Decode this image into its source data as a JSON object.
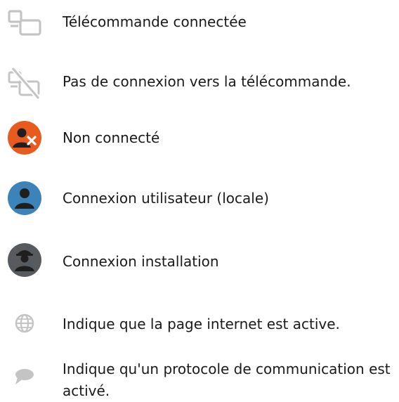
{
  "colors": {
    "icon_grey": "#c4c4c4",
    "not_connected_orange": "#e85a1e",
    "user_blue": "#3b83b8",
    "installer_dark": "#575b60",
    "text": "#1a1a1a"
  },
  "legend": {
    "items": [
      {
        "icon": "remote-connected-icon",
        "label": "Télécommande connectée"
      },
      {
        "icon": "remote-disconnected-icon",
        "label": "Pas de connexion vers la télécommande."
      },
      {
        "icon": "not-connected-user-icon",
        "label": "Non connecté"
      },
      {
        "icon": "user-connection-icon",
        "label": "Connexion utilisateur (locale)"
      },
      {
        "icon": "installer-connection-icon",
        "label": "Connexion installation"
      },
      {
        "icon": "globe-icon",
        "label": "Indique que la page internet est active."
      },
      {
        "icon": "speech-bubble-icon",
        "label": "Indique qu'un protocole de communication est activé."
      }
    ]
  }
}
